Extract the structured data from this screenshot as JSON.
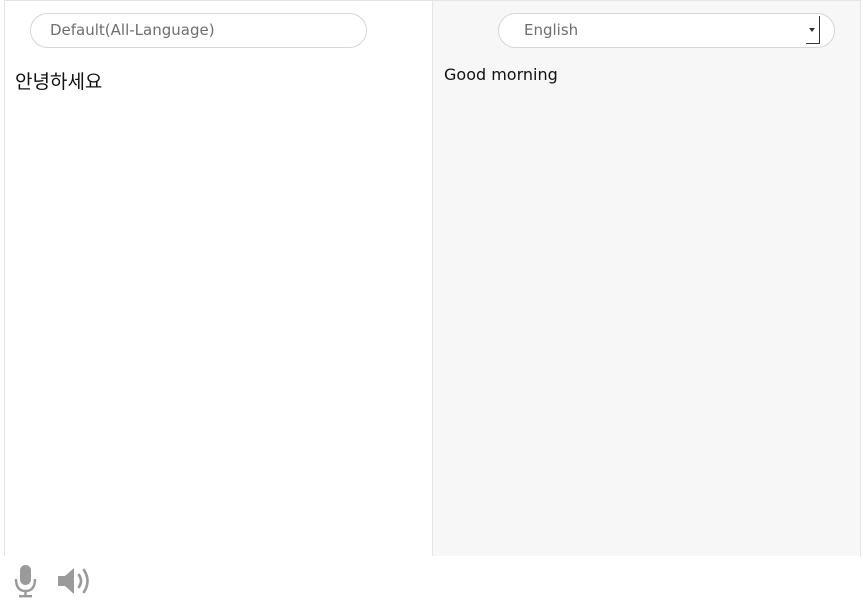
{
  "source": {
    "language_label": "Default(All-Language)",
    "text": "안녕하세요"
  },
  "target": {
    "language_label": "English",
    "text": "Good morning"
  },
  "toolbar": {
    "mic_icon": "microphone-icon",
    "speaker_icon": "speaker-icon"
  },
  "colors": {
    "target_background": "#f7f7f7",
    "border": "#e4e4e4",
    "icon": "#9a9a9a"
  }
}
